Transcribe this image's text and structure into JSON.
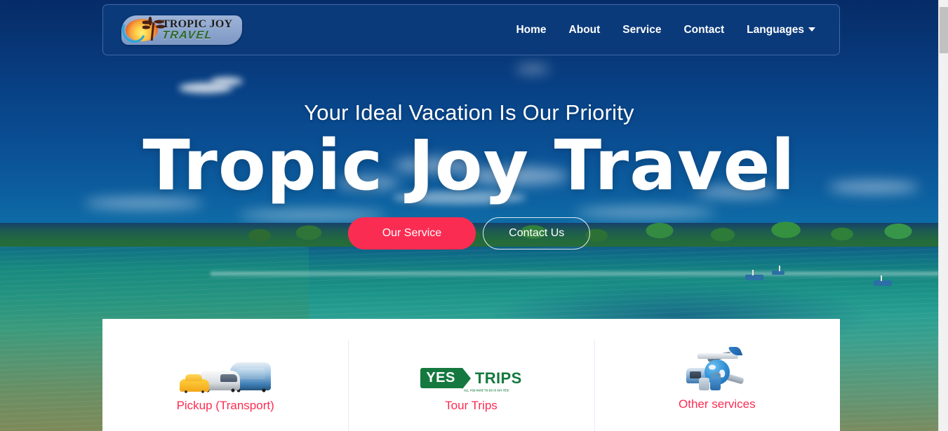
{
  "site": {
    "logo": {
      "line1": "TROPIC JOY",
      "line2": "TRAVEL",
      "alt": "Tropic Joy Travel logo"
    }
  },
  "nav": {
    "items": [
      {
        "label": "Home"
      },
      {
        "label": "About"
      },
      {
        "label": "Service"
      },
      {
        "label": "Contact"
      },
      {
        "label": "Languages",
        "has_dropdown": true
      }
    ]
  },
  "hero": {
    "tagline": "Your Ideal Vacation Is Our Priority",
    "title": "Tropic Joy Travel",
    "primary_button": "Our Service",
    "secondary_button": "Contact Us"
  },
  "services": {
    "cards": [
      {
        "label": "Pickup (Transport)",
        "icon": "vehicles-icon"
      },
      {
        "label": "Tour Trips",
        "icon": "yes-trips-logo",
        "logo_tag": "YES",
        "logo_word": "TRIPS",
        "logo_sub": "ALL YOU HAVE TO DO IS SAY YES!"
      },
      {
        "label": "Other services",
        "icon": "plane-globe-luggage-icon"
      }
    ]
  },
  "colors": {
    "accent_pink": "#fb2c52",
    "header_navy": "#0a3a7a",
    "logo_green": "#15793f",
    "panel_white": "#ffffff",
    "divider": "#e3ecf8"
  }
}
